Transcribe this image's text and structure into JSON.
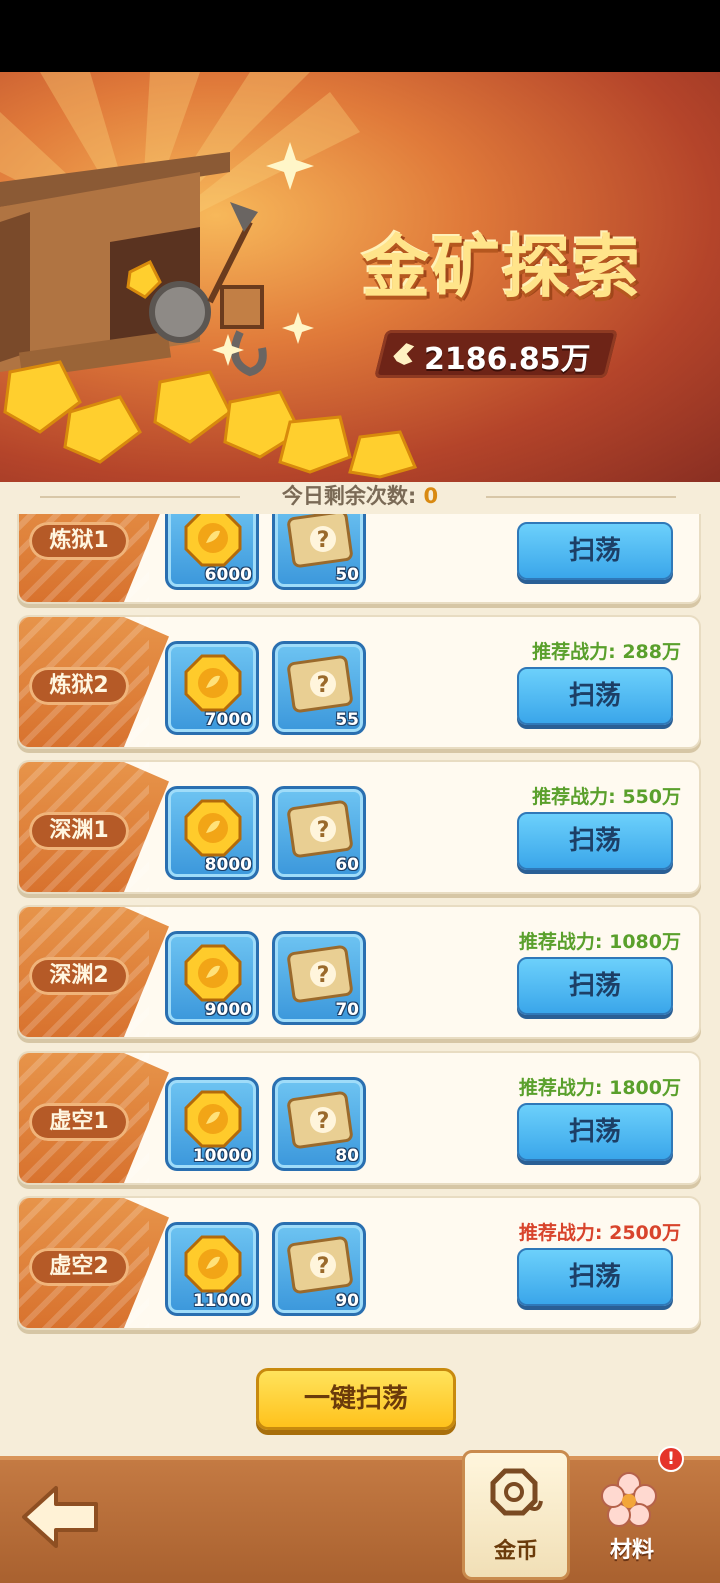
{
  "banner": {
    "title": "金矿探索",
    "total_power": "2186.85万"
  },
  "daily": {
    "label": "今日剩余次数:",
    "count": "0"
  },
  "levels": [
    {
      "name": "炼狱1",
      "coin_qty": "6000",
      "scroll_qty": "50",
      "recommended_power": "",
      "button": "扫荡"
    },
    {
      "name": "炼狱2",
      "coin_qty": "7000",
      "scroll_qty": "55",
      "recommended_power": "推荐战力: 288万",
      "button": "扫荡"
    },
    {
      "name": "深渊1",
      "coin_qty": "8000",
      "scroll_qty": "60",
      "recommended_power": "推荐战力: 550万",
      "button": "扫荡"
    },
    {
      "name": "深渊2",
      "coin_qty": "9000",
      "scroll_qty": "70",
      "recommended_power": "推荐战力: 1080万",
      "button": "扫荡"
    },
    {
      "name": "虚空1",
      "coin_qty": "10000",
      "scroll_qty": "80",
      "recommended_power": "推荐战力: 1800万",
      "button": "扫荡"
    },
    {
      "name": "虚空2",
      "coin_qty": "11000",
      "scroll_qty": "90",
      "recommended_power": "推荐战力: 2500万",
      "button": "扫荡"
    }
  ],
  "colors": {
    "power_ok": "#5aa02c",
    "power_warn": "#d8442c"
  },
  "onekey_button": "一键扫荡",
  "bottom_nav": {
    "back_icon": "back-arrow-icon",
    "tabs": [
      {
        "label": "金币",
        "icon": "coin-icon",
        "selected": true
      },
      {
        "label": "材料",
        "icon": "flower-icon",
        "selected": false,
        "badge": "!"
      }
    ]
  }
}
